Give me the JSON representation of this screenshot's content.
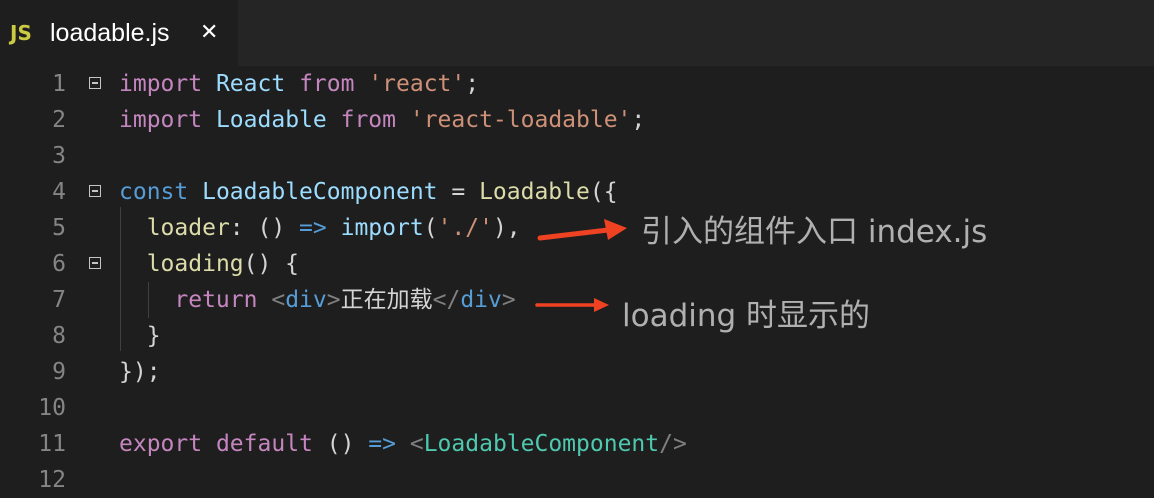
{
  "tab": {
    "icon": "JS",
    "title": "loadable.js",
    "close": "✕"
  },
  "line_numbers": [
    "1",
    "2",
    "3",
    "4",
    "5",
    "6",
    "7",
    "8",
    "9",
    "10",
    "11",
    "12"
  ],
  "code": {
    "l1": [
      "import",
      " ",
      "React",
      " ",
      "from",
      " ",
      "'react'",
      ";"
    ],
    "l2": [
      "import",
      " ",
      "Loadable",
      " ",
      "from",
      " ",
      "'react-loadable'",
      ";"
    ],
    "l4": [
      "const",
      " ",
      "LoadableComponent",
      " = ",
      "Loadable",
      "({"
    ],
    "l5": [
      "  ",
      "loader",
      ": () ",
      "=>",
      " ",
      "import",
      "(",
      "'./'",
      "),"
    ],
    "l6": [
      "  ",
      "loading",
      "() {"
    ],
    "l7": [
      "    ",
      "return",
      " ",
      "<",
      "div",
      ">",
      "正在加载",
      "</",
      "div",
      ">"
    ],
    "l8": [
      "  }"
    ],
    "l9": [
      "});"
    ],
    "l11": [
      "export",
      " ",
      "default",
      " () ",
      "=>",
      " ",
      "<",
      "LoadableComponent",
      "/>"
    ]
  },
  "annotations": {
    "entry": "引入的组件入口 index.js",
    "loading": "loading 时显示的",
    "arrow_color": "#ee4223"
  },
  "colors": {
    "keyword": "#c586c0",
    "identifier": "#9cdcfe",
    "string": "#ce9178",
    "function": "#dcdcaa",
    "tag": "#569cd6",
    "component": "#4ec9b0"
  }
}
